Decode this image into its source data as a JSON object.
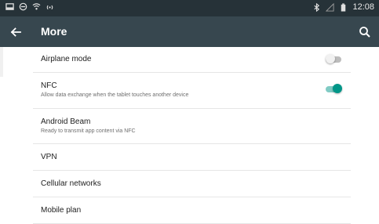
{
  "status_bar": {
    "time": "12:08",
    "left_icons": [
      "notification-icon",
      "minus-circle-icon",
      "wifi-icon",
      "hotspot-icon"
    ],
    "right_icons": [
      "bluetooth-icon",
      "signal-icon",
      "battery-icon"
    ]
  },
  "toolbar": {
    "title": "More",
    "back_icon": "arrow-back-icon",
    "search_icon": "search-icon",
    "background": "#37474f"
  },
  "settings": {
    "airplane": {
      "title": "Airplane mode",
      "enabled": false
    },
    "nfc": {
      "title": "NFC",
      "summary": "Allow data exchange when the tablet touches another device",
      "enabled": true
    },
    "beam": {
      "title": "Android Beam",
      "summary": "Ready to transmit app content via NFC"
    },
    "vpn": {
      "title": "VPN"
    },
    "cellular": {
      "title": "Cellular networks"
    },
    "mobile_plan": {
      "title": "Mobile plan"
    }
  },
  "colors": {
    "accent": "#009688",
    "status_bar": "#263238"
  }
}
